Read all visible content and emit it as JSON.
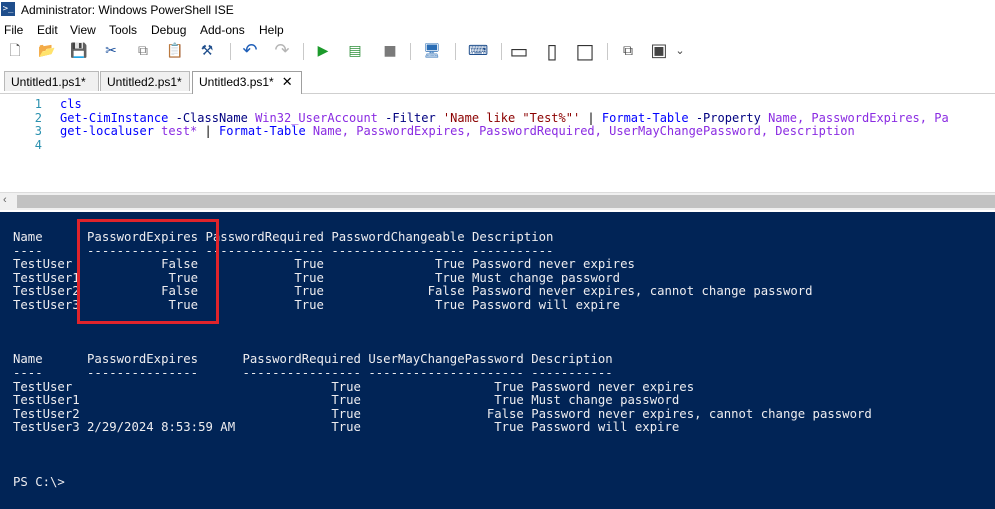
{
  "window": {
    "title": "Administrator: Windows PowerShell ISE"
  },
  "menu": [
    "File",
    "Edit",
    "View",
    "Tools",
    "Debug",
    "Add-ons",
    "Help"
  ],
  "toolbar_icons": [
    {
      "name": "new-file-icon",
      "glyph": "🗋"
    },
    {
      "name": "open-folder-icon",
      "glyph": "📂"
    },
    {
      "name": "save-icon",
      "glyph": "💾"
    },
    {
      "name": "cut-icon",
      "glyph": "✂"
    },
    {
      "name": "copy-icon",
      "glyph": "⧉"
    },
    {
      "name": "paste-icon",
      "glyph": "📋"
    },
    {
      "name": "clear-console-icon",
      "glyph": "⚒"
    },
    {
      "name": "undo-icon",
      "glyph": "↶"
    },
    {
      "name": "redo-icon",
      "glyph": "↷"
    },
    {
      "name": "run-script-icon",
      "glyph": "▶"
    },
    {
      "name": "run-selection-icon",
      "glyph": "▤"
    },
    {
      "name": "stop-icon",
      "glyph": "■"
    },
    {
      "name": "remote-powershell-icon",
      "glyph": "🖥"
    },
    {
      "name": "start-powershell-icon",
      "glyph": "⌨"
    },
    {
      "name": "layout-top-icon",
      "glyph": "▭"
    },
    {
      "name": "layout-right-icon",
      "glyph": "▯"
    },
    {
      "name": "layout-maximize-icon",
      "glyph": "□"
    },
    {
      "name": "show-script-pane-icon",
      "glyph": "⧉"
    },
    {
      "name": "show-commands-icon",
      "glyph": "▣"
    },
    {
      "name": "toolbar-overflow-icon",
      "glyph": "⌄"
    }
  ],
  "tabs": [
    {
      "label": "Untitled1.ps1*"
    },
    {
      "label": "Untitled2.ps1*"
    },
    {
      "label": "Untitled3.ps1*",
      "close": "✕"
    }
  ],
  "editor": {
    "line_numbers": [
      "1",
      "2",
      "3",
      "4"
    ],
    "line1": {
      "cmd": "cls"
    },
    "line2": {
      "cmd1": "Get-CimInstance",
      "p1": " -ClassName",
      "a1": " Win32_UserAccount",
      "p2": " -Filter",
      "s1": " 'Name like \"Test%\"'",
      "pipe": " | ",
      "cmd2": "Format-Table",
      "p3": " -Property",
      "rest": " Name, PasswordExpires, Pa"
    },
    "line3": {
      "cmd1": "get-localuser",
      "a1": " test*",
      "pipe": " | ",
      "cmd2": "Format-Table",
      "rest": " Name, PasswordExpires, PasswordRequired, UserMayChangePassword, Description"
    }
  },
  "console": {
    "lines": [
      "Name      PasswordExpires PasswordRequired PasswordChangeable Description",
      "----      --------------- ---------------- ------------------ -----------",
      "TestUser            False             True               True Password never expires",
      "TestUser1            True             True               True Must change password",
      "TestUser2           False             True              False Password never expires, cannot change password",
      "TestUser3            True             True               True Password will expire",
      "",
      "",
      "",
      "Name      PasswordExpires      PasswordRequired UserMayChangePassword Description",
      "----      ---------------      ---------------- --------------------- -----------",
      "TestUser                                   True                  True Password never expires",
      "TestUser1                                  True                  True Must change password",
      "TestUser2                                  True                 False Password never expires, cannot change password",
      "TestUser3 2/29/2024 8:53:59 AM             True                  True Password will expire",
      "",
      "",
      "",
      "",
      "PS C:\\>"
    ]
  },
  "colors": {
    "console_bg": "#012456",
    "console_fg": "#eeedf0",
    "highlight": "#e0242b"
  }
}
